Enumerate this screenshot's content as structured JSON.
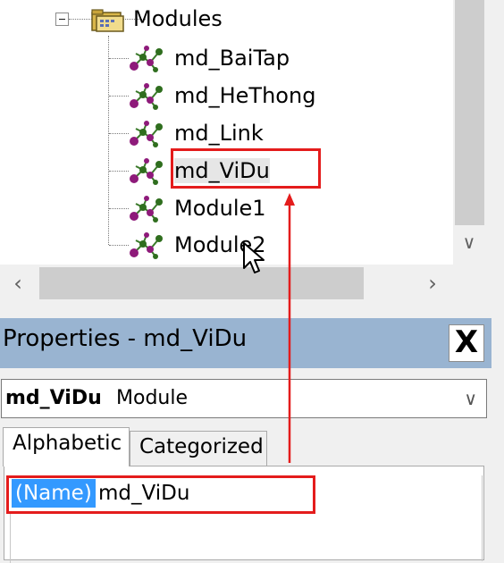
{
  "project_tree": {
    "folder": {
      "label": "Modules",
      "icon": "folder-icon",
      "expanded": true
    },
    "modules": [
      {
        "label": "md_BaiTap",
        "icon": "module-icon"
      },
      {
        "label": "md_HeThong",
        "icon": "module-icon"
      },
      {
        "label": "md_Link",
        "icon": "module-icon"
      },
      {
        "label": "md_ViDu",
        "icon": "module-icon",
        "selected": true
      },
      {
        "label": "Module1",
        "icon": "module-icon"
      },
      {
        "label": "Module2",
        "icon": "module-icon"
      }
    ]
  },
  "properties": {
    "title": "Properties - md_ViDu",
    "close_label": "X",
    "object_name": "md_ViDu",
    "object_type": "Module",
    "tabs": [
      {
        "label": "Alphabetic",
        "active": true
      },
      {
        "label": "Categorized",
        "active": false
      }
    ],
    "rows": [
      {
        "name": "(Name)",
        "value": "md_ViDu"
      }
    ]
  },
  "colors": {
    "highlight_box": "#e41c1c",
    "title_bar": "#99b4d1",
    "selection": "#3399ff"
  }
}
